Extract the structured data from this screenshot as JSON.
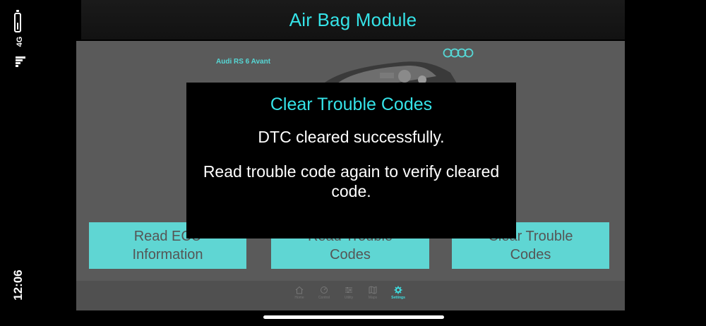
{
  "status_bar": {
    "network": "4G",
    "time": "12:06"
  },
  "header": {
    "title": "Air Bag Module"
  },
  "vehicle": {
    "model": "Audi RS 6 Avant",
    "brand_logo": "audi-rings-icon"
  },
  "actions": [
    {
      "label": "Read ECU\nInformation"
    },
    {
      "label": "Read Trouble\nCodes"
    },
    {
      "label": "Clear Trouble\nCodes"
    }
  ],
  "dialog": {
    "title": "Clear Trouble Codes",
    "message": "DTC cleared successfully.",
    "detail": "Read trouble code again to verify cleared code."
  },
  "bottom_nav": {
    "items": [
      {
        "label": "Home",
        "icon": "home-icon"
      },
      {
        "label": "Control",
        "icon": "gauge-icon"
      },
      {
        "label": "Utility",
        "icon": "sliders-icon"
      },
      {
        "label": "Maps",
        "icon": "map-icon"
      },
      {
        "label": "Settings",
        "icon": "gear-icon",
        "active": true
      }
    ]
  },
  "colors": {
    "accent": "#35e3e8",
    "button": "#5fd6d3",
    "panel": "#5a5a5a",
    "background": "#000000"
  }
}
